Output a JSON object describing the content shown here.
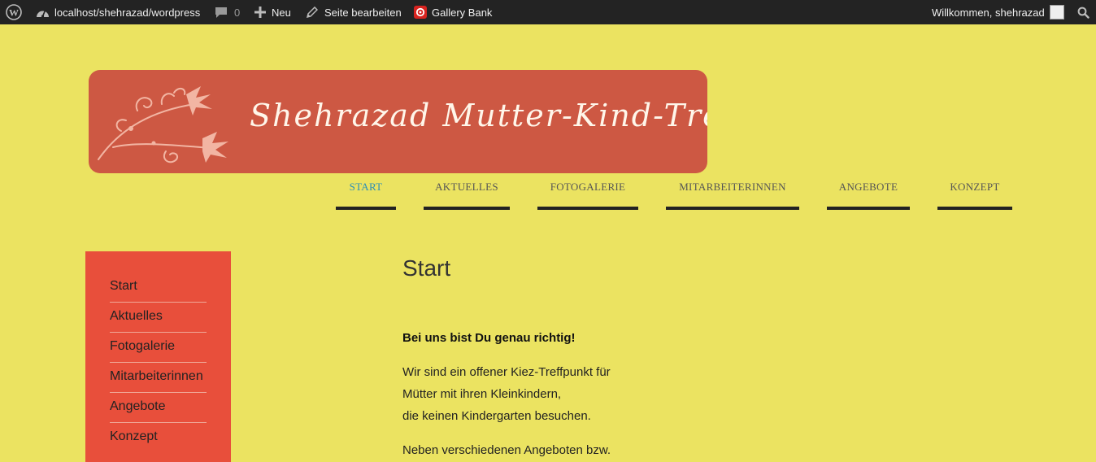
{
  "admin_bar": {
    "site_url": "localhost/shehrazad/wordpress",
    "comments_count": "0",
    "new_label": "Neu",
    "edit_label": "Seite bearbeiten",
    "gallery_label": "Gallery Bank",
    "greeting": "Willkommen, shehrazad",
    "icons": [
      "wordpress-logo-icon",
      "dashboard-icon",
      "comment-icon",
      "plus-icon",
      "pencil-icon",
      "gallery-bank-icon",
      "search-icon"
    ]
  },
  "header": {
    "title": "Shehrazad Mutter-Kind-Treff",
    "colors": {
      "banner": "#cd5843",
      "page_bg": "#ebe361"
    }
  },
  "nav": {
    "items": [
      {
        "label": "START"
      },
      {
        "label": "AKTUELLES"
      },
      {
        "label": "FOTOGALERIE"
      },
      {
        "label": "MITARBEITERINNEN"
      },
      {
        "label": "ANGEBOTE"
      },
      {
        "label": "KONZEPT"
      }
    ],
    "active_index": 0,
    "active_color": "#2b8fb8"
  },
  "sidebar": {
    "items": [
      {
        "label": "Start"
      },
      {
        "label": "Aktuelles"
      },
      {
        "label": "Fotogalerie"
      },
      {
        "label": "Mitarbeiterinnen"
      },
      {
        "label": "Angebote"
      },
      {
        "label": "Konzept"
      }
    ],
    "color": "#e84f3b"
  },
  "content": {
    "title": "Start",
    "lead": "Bei uns bist Du  genau richtig!",
    "p1_line1": "Wir sind ein offener Kiez-Treffpunkt für",
    "p1_line2": "Mütter mit ihren Kleinkindern,",
    "p1_line3": "die keinen Kindergarten besuchen.",
    "p2_line1": "Neben verschiedenen Angeboten bzw."
  }
}
